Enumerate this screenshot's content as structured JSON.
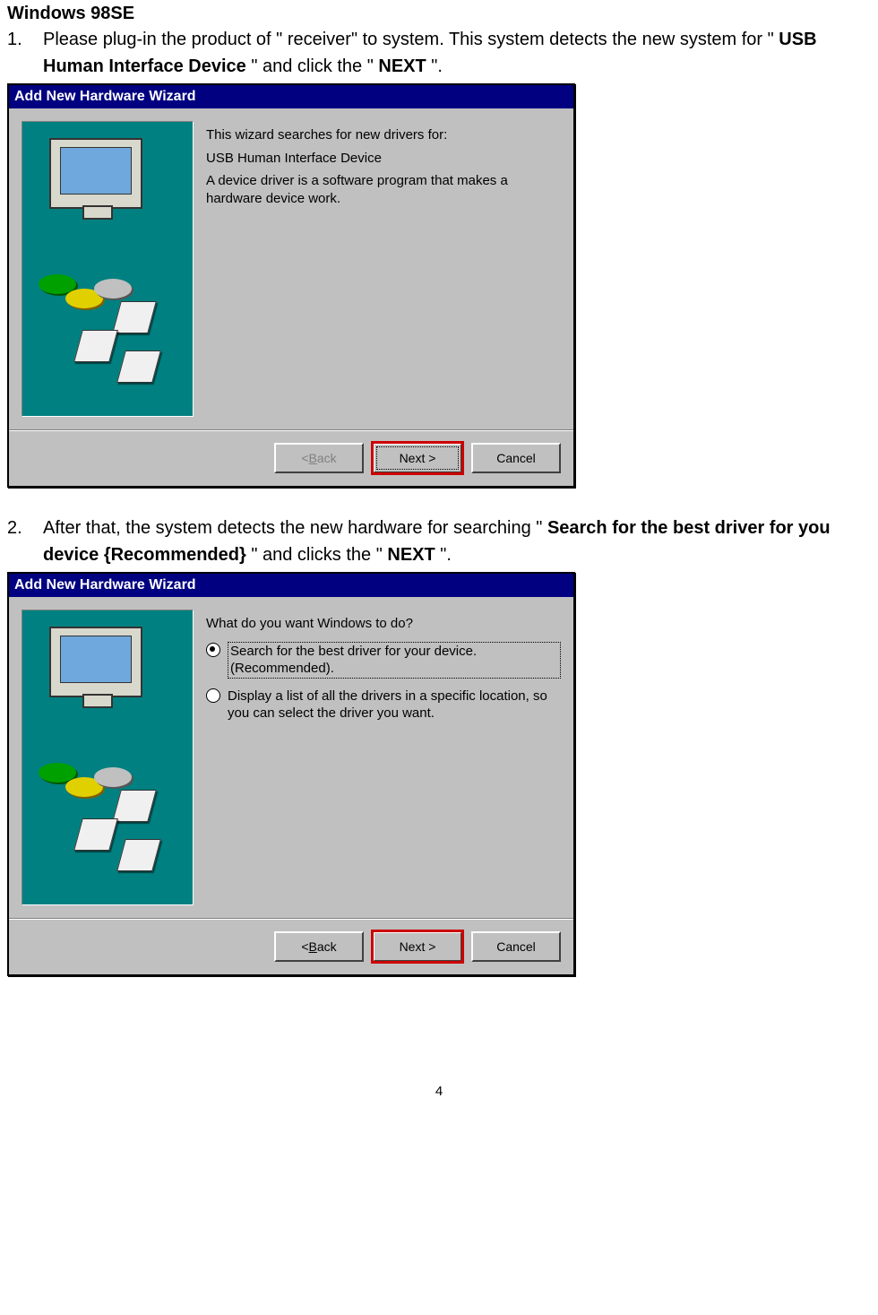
{
  "doc": {
    "heading": "Windows 98SE",
    "page_number": "4",
    "step1": {
      "num": "1.",
      "pre": "Please plug-in the product of \" receiver\" to system. This system detects the new system for \" ",
      "bold1": "USB Human Interface Device",
      "mid": " \" and click the \" ",
      "bold2": "NEXT",
      "post": " \"."
    },
    "step2": {
      "num": "2.",
      "pre": "After that, the system detects the new hardware for searching \" ",
      "bold1": "Search for the best driver for you device {Recommended}",
      "mid": " \" and clicks the \" ",
      "bold2": "NEXT",
      "post": " \"."
    }
  },
  "wizard1": {
    "title": "Add New Hardware Wizard",
    "line1": "This wizard searches for new drivers for:",
    "device": "USB Human Interface Device",
    "line2": "A device driver is a software program that makes a hardware device work.",
    "buttons": {
      "back_pre": "< ",
      "back_u": "B",
      "back_post": "ack",
      "next": "Next >",
      "cancel": "Cancel"
    }
  },
  "wizard2": {
    "title": "Add New Hardware Wizard",
    "question": "What do you want Windows to do?",
    "opt1": "Search for the best driver for your device. (Recommended).",
    "opt2": "Display a list of all the drivers in a specific location, so you can select the driver you want.",
    "buttons": {
      "back_pre": "< ",
      "back_u": "B",
      "back_post": "ack",
      "next": "Next >",
      "cancel": "Cancel"
    }
  }
}
